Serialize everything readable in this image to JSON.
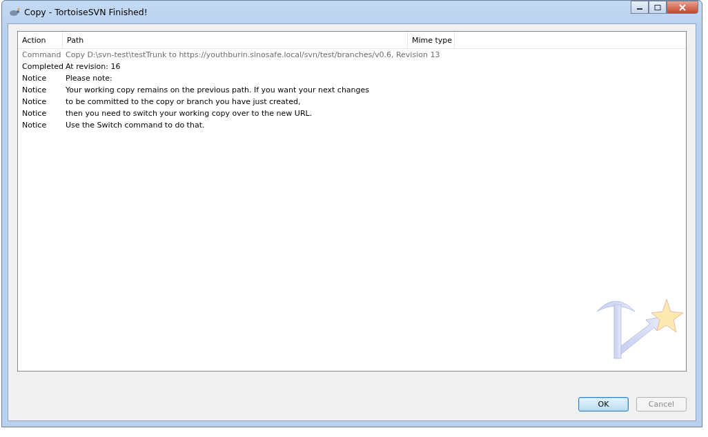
{
  "window": {
    "title": "Copy - TortoiseSVN Finished!"
  },
  "table": {
    "columns": [
      "Action",
      "Path",
      "Mime type"
    ],
    "rows": [
      {
        "kind": "command",
        "action": "Command",
        "path": "Copy D:\\svn-test\\testTrunk to https://youthburin.sinosafe.local/svn/test/branches/v0.6, Revision 13"
      },
      {
        "kind": "completed",
        "action": "Completed",
        "path": "At revision: 16"
      },
      {
        "kind": "notice",
        "action": "Notice",
        "path": "Please note:"
      },
      {
        "kind": "notice",
        "action": "Notice",
        "path": "Your working copy remains on the previous path. If you want your next changes"
      },
      {
        "kind": "notice",
        "action": "Notice",
        "path": "to be committed to the copy or branch you have just created,"
      },
      {
        "kind": "notice",
        "action": "Notice",
        "path": "then you need to switch your working copy over to the new URL."
      },
      {
        "kind": "notice",
        "action": "Notice",
        "path": "Use the Switch command to do that."
      }
    ]
  },
  "buttons": [
    {
      "label": "OK",
      "disabled": false
    },
    {
      "label": "Cancel",
      "disabled": true
    }
  ]
}
